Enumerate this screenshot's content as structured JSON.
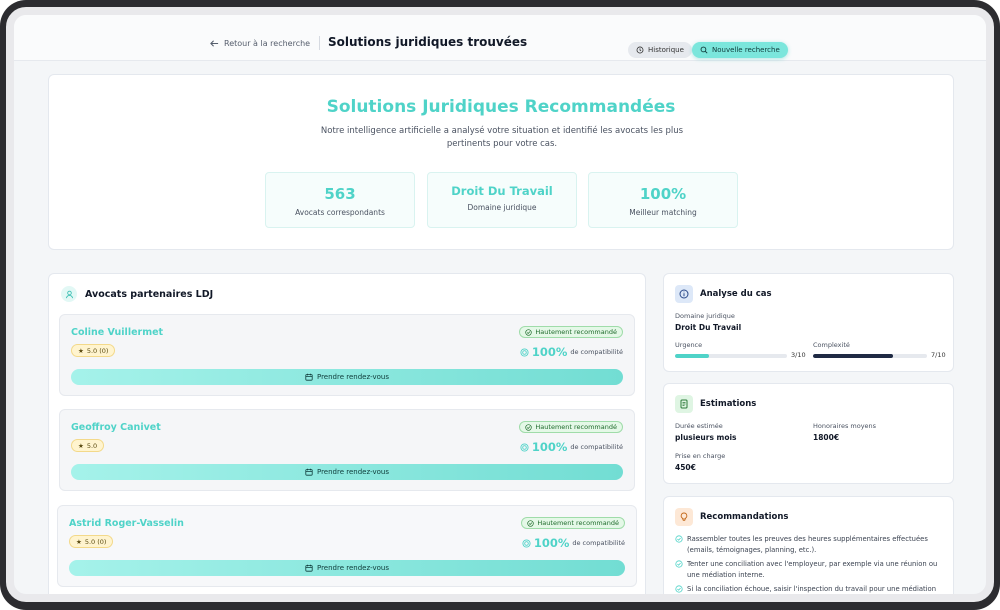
{
  "header": {
    "back_label": "Retour à la recherche",
    "page_title": "Solutions juridiques trouvées",
    "history_label": "Historique",
    "new_search_label": "Nouvelle recherche"
  },
  "hero": {
    "title": "Solutions Juridiques Recommandées",
    "description": "Notre intelligence artificielle a analysé votre situation et identifié les avocats les plus pertinents pour votre cas.",
    "stats": [
      {
        "value": "563",
        "label": "Avocats correspondants"
      },
      {
        "value": "Droit Du Travail",
        "label": "Domaine juridique"
      },
      {
        "value": "100%",
        "label": "Meilleur matching"
      }
    ]
  },
  "lawyers": {
    "title": "Avocats partenaires LDJ",
    "badge_label": "Hautement recommandé",
    "compat_label": "de compatibilité",
    "rdv_label": "Prendre rendez-vous",
    "items": [
      {
        "name": "Coline Vuillermet",
        "rating": "5.0 (0)",
        "compat": "100%"
      },
      {
        "name": "Geoffroy Canivet",
        "rating": "5.0",
        "compat": "100%"
      },
      {
        "name": "Astrid Roger-Vasselin",
        "rating": "5.0 (0)",
        "compat": "100%"
      }
    ]
  },
  "analysis": {
    "title": "Analyse du cas",
    "domain_label": "Domaine juridique",
    "domain_value": "Droit Du Travail",
    "urgency_label": "Urgence",
    "urgency_value": "3/10",
    "urgency_level": 0.3,
    "complexity_label": "Complexité",
    "complexity_value": "7/10",
    "complexity_level": 0.7
  },
  "estimations": {
    "title": "Estimations",
    "duration_label": "Durée estimée",
    "duration_value": "plusieurs mois",
    "fees_label": "Honoraires moyens",
    "fees_value": "1800€",
    "care_label": "Prise en charge",
    "care_value": "450€"
  },
  "recommendations": {
    "title": "Recommandations",
    "items": [
      "Rassembler toutes les preuves des heures supplémentaires effectuées (emails, témoignages, planning, etc.).",
      "Tenter une conciliation avec l'employeur, par exemple via une réunion ou une médiation interne.",
      "Si la conciliation échoue, saisir l'inspection du travail pour une médiation"
    ]
  },
  "colors": {
    "accent": "#4fd3c8",
    "accent_button": "#7be6dc",
    "urgency_bar": "#4fd3c8",
    "complexity_bar": "#1f2a44"
  }
}
